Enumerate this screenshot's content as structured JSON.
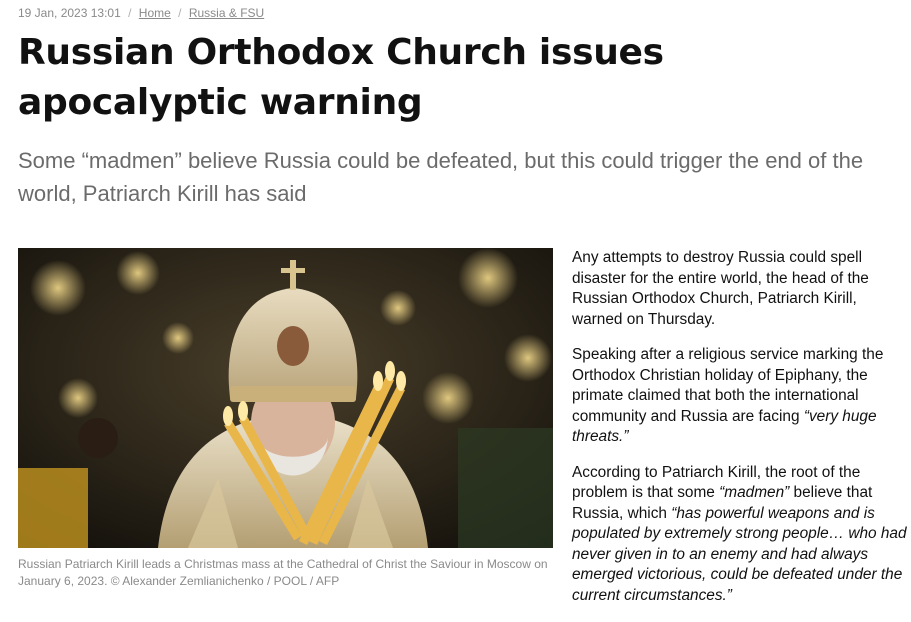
{
  "meta": {
    "date": "19 Jan, 2023 13:01",
    "breadcrumb": [
      "Home",
      "Russia & FSU"
    ]
  },
  "article": {
    "title": "Russian Orthodox Church issues apocalyptic warning",
    "subtitle": "Some “madmen” believe Russia could be defeated, but this could trigger the end of the world, Patriarch Kirill has said",
    "image_caption": "Russian Patriarch Kirill leads a Christmas mass at the Cathedral of Christ the Saviour in Moscow on January 6, 2023. © Alexander Zemlianichenko / POOL / AFP",
    "paragraphs": [
      [
        {
          "text": "Any attempts to destroy Russia could spell disaster for the entire world, the head of the Russian Orthodox Church, Patriarch Kirill, warned on Thursday.",
          "italic": false
        }
      ],
      [
        {
          "text": "Speaking after a religious service marking the Orthodox Christian holiday of Epiphany, the primate claimed that both the international community and Russia are facing ",
          "italic": false
        },
        {
          "text": "“very huge threats.”",
          "italic": true
        }
      ],
      [
        {
          "text": "According to Patriarch Kirill, the root of the problem is that some ",
          "italic": false
        },
        {
          "text": "“madmen”",
          "italic": true
        },
        {
          "text": " believe that Russia, which ",
          "italic": false
        },
        {
          "text": "“has powerful weapons and is populated by extremely strong people… who had never given in to an enemy and had always emerged victorious, could be defeated under the current circumstances.”",
          "italic": true
        }
      ]
    ]
  }
}
